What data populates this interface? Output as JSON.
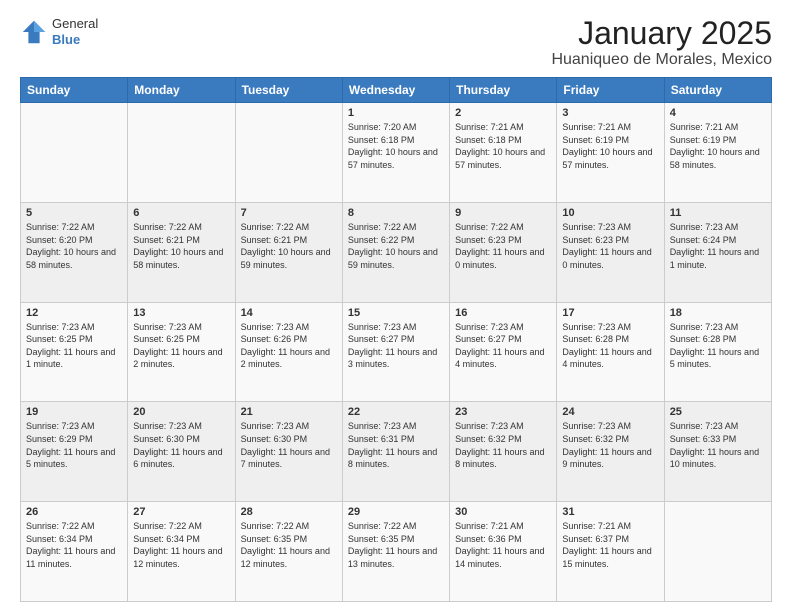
{
  "header": {
    "logo": {
      "general": "General",
      "blue": "Blue"
    },
    "title": "January 2025",
    "subtitle": "Huaniqueo de Morales, Mexico"
  },
  "weekdays": [
    "Sunday",
    "Monday",
    "Tuesday",
    "Wednesday",
    "Thursday",
    "Friday",
    "Saturday"
  ],
  "weeks": [
    [
      {
        "day": "",
        "sunrise": "",
        "sunset": "",
        "daylight": ""
      },
      {
        "day": "",
        "sunrise": "",
        "sunset": "",
        "daylight": ""
      },
      {
        "day": "",
        "sunrise": "",
        "sunset": "",
        "daylight": ""
      },
      {
        "day": "1",
        "sunrise": "Sunrise: 7:20 AM",
        "sunset": "Sunset: 6:18 PM",
        "daylight": "Daylight: 10 hours and 57 minutes."
      },
      {
        "day": "2",
        "sunrise": "Sunrise: 7:21 AM",
        "sunset": "Sunset: 6:18 PM",
        "daylight": "Daylight: 10 hours and 57 minutes."
      },
      {
        "day": "3",
        "sunrise": "Sunrise: 7:21 AM",
        "sunset": "Sunset: 6:19 PM",
        "daylight": "Daylight: 10 hours and 57 minutes."
      },
      {
        "day": "4",
        "sunrise": "Sunrise: 7:21 AM",
        "sunset": "Sunset: 6:19 PM",
        "daylight": "Daylight: 10 hours and 58 minutes."
      }
    ],
    [
      {
        "day": "5",
        "sunrise": "Sunrise: 7:22 AM",
        "sunset": "Sunset: 6:20 PM",
        "daylight": "Daylight: 10 hours and 58 minutes."
      },
      {
        "day": "6",
        "sunrise": "Sunrise: 7:22 AM",
        "sunset": "Sunset: 6:21 PM",
        "daylight": "Daylight: 10 hours and 58 minutes."
      },
      {
        "day": "7",
        "sunrise": "Sunrise: 7:22 AM",
        "sunset": "Sunset: 6:21 PM",
        "daylight": "Daylight: 10 hours and 59 minutes."
      },
      {
        "day": "8",
        "sunrise": "Sunrise: 7:22 AM",
        "sunset": "Sunset: 6:22 PM",
        "daylight": "Daylight: 10 hours and 59 minutes."
      },
      {
        "day": "9",
        "sunrise": "Sunrise: 7:22 AM",
        "sunset": "Sunset: 6:23 PM",
        "daylight": "Daylight: 11 hours and 0 minutes."
      },
      {
        "day": "10",
        "sunrise": "Sunrise: 7:23 AM",
        "sunset": "Sunset: 6:23 PM",
        "daylight": "Daylight: 11 hours and 0 minutes."
      },
      {
        "day": "11",
        "sunrise": "Sunrise: 7:23 AM",
        "sunset": "Sunset: 6:24 PM",
        "daylight": "Daylight: 11 hours and 1 minute."
      }
    ],
    [
      {
        "day": "12",
        "sunrise": "Sunrise: 7:23 AM",
        "sunset": "Sunset: 6:25 PM",
        "daylight": "Daylight: 11 hours and 1 minute."
      },
      {
        "day": "13",
        "sunrise": "Sunrise: 7:23 AM",
        "sunset": "Sunset: 6:25 PM",
        "daylight": "Daylight: 11 hours and 2 minutes."
      },
      {
        "day": "14",
        "sunrise": "Sunrise: 7:23 AM",
        "sunset": "Sunset: 6:26 PM",
        "daylight": "Daylight: 11 hours and 2 minutes."
      },
      {
        "day": "15",
        "sunrise": "Sunrise: 7:23 AM",
        "sunset": "Sunset: 6:27 PM",
        "daylight": "Daylight: 11 hours and 3 minutes."
      },
      {
        "day": "16",
        "sunrise": "Sunrise: 7:23 AM",
        "sunset": "Sunset: 6:27 PM",
        "daylight": "Daylight: 11 hours and 4 minutes."
      },
      {
        "day": "17",
        "sunrise": "Sunrise: 7:23 AM",
        "sunset": "Sunset: 6:28 PM",
        "daylight": "Daylight: 11 hours and 4 minutes."
      },
      {
        "day": "18",
        "sunrise": "Sunrise: 7:23 AM",
        "sunset": "Sunset: 6:28 PM",
        "daylight": "Daylight: 11 hours and 5 minutes."
      }
    ],
    [
      {
        "day": "19",
        "sunrise": "Sunrise: 7:23 AM",
        "sunset": "Sunset: 6:29 PM",
        "daylight": "Daylight: 11 hours and 5 minutes."
      },
      {
        "day": "20",
        "sunrise": "Sunrise: 7:23 AM",
        "sunset": "Sunset: 6:30 PM",
        "daylight": "Daylight: 11 hours and 6 minutes."
      },
      {
        "day": "21",
        "sunrise": "Sunrise: 7:23 AM",
        "sunset": "Sunset: 6:30 PM",
        "daylight": "Daylight: 11 hours and 7 minutes."
      },
      {
        "day": "22",
        "sunrise": "Sunrise: 7:23 AM",
        "sunset": "Sunset: 6:31 PM",
        "daylight": "Daylight: 11 hours and 8 minutes."
      },
      {
        "day": "23",
        "sunrise": "Sunrise: 7:23 AM",
        "sunset": "Sunset: 6:32 PM",
        "daylight": "Daylight: 11 hours and 8 minutes."
      },
      {
        "day": "24",
        "sunrise": "Sunrise: 7:23 AM",
        "sunset": "Sunset: 6:32 PM",
        "daylight": "Daylight: 11 hours and 9 minutes."
      },
      {
        "day": "25",
        "sunrise": "Sunrise: 7:23 AM",
        "sunset": "Sunset: 6:33 PM",
        "daylight": "Daylight: 11 hours and 10 minutes."
      }
    ],
    [
      {
        "day": "26",
        "sunrise": "Sunrise: 7:22 AM",
        "sunset": "Sunset: 6:34 PM",
        "daylight": "Daylight: 11 hours and 11 minutes."
      },
      {
        "day": "27",
        "sunrise": "Sunrise: 7:22 AM",
        "sunset": "Sunset: 6:34 PM",
        "daylight": "Daylight: 11 hours and 12 minutes."
      },
      {
        "day": "28",
        "sunrise": "Sunrise: 7:22 AM",
        "sunset": "Sunset: 6:35 PM",
        "daylight": "Daylight: 11 hours and 12 minutes."
      },
      {
        "day": "29",
        "sunrise": "Sunrise: 7:22 AM",
        "sunset": "Sunset: 6:35 PM",
        "daylight": "Daylight: 11 hours and 13 minutes."
      },
      {
        "day": "30",
        "sunrise": "Sunrise: 7:21 AM",
        "sunset": "Sunset: 6:36 PM",
        "daylight": "Daylight: 11 hours and 14 minutes."
      },
      {
        "day": "31",
        "sunrise": "Sunrise: 7:21 AM",
        "sunset": "Sunset: 6:37 PM",
        "daylight": "Daylight: 11 hours and 15 minutes."
      },
      {
        "day": "",
        "sunrise": "",
        "sunset": "",
        "daylight": ""
      }
    ]
  ]
}
